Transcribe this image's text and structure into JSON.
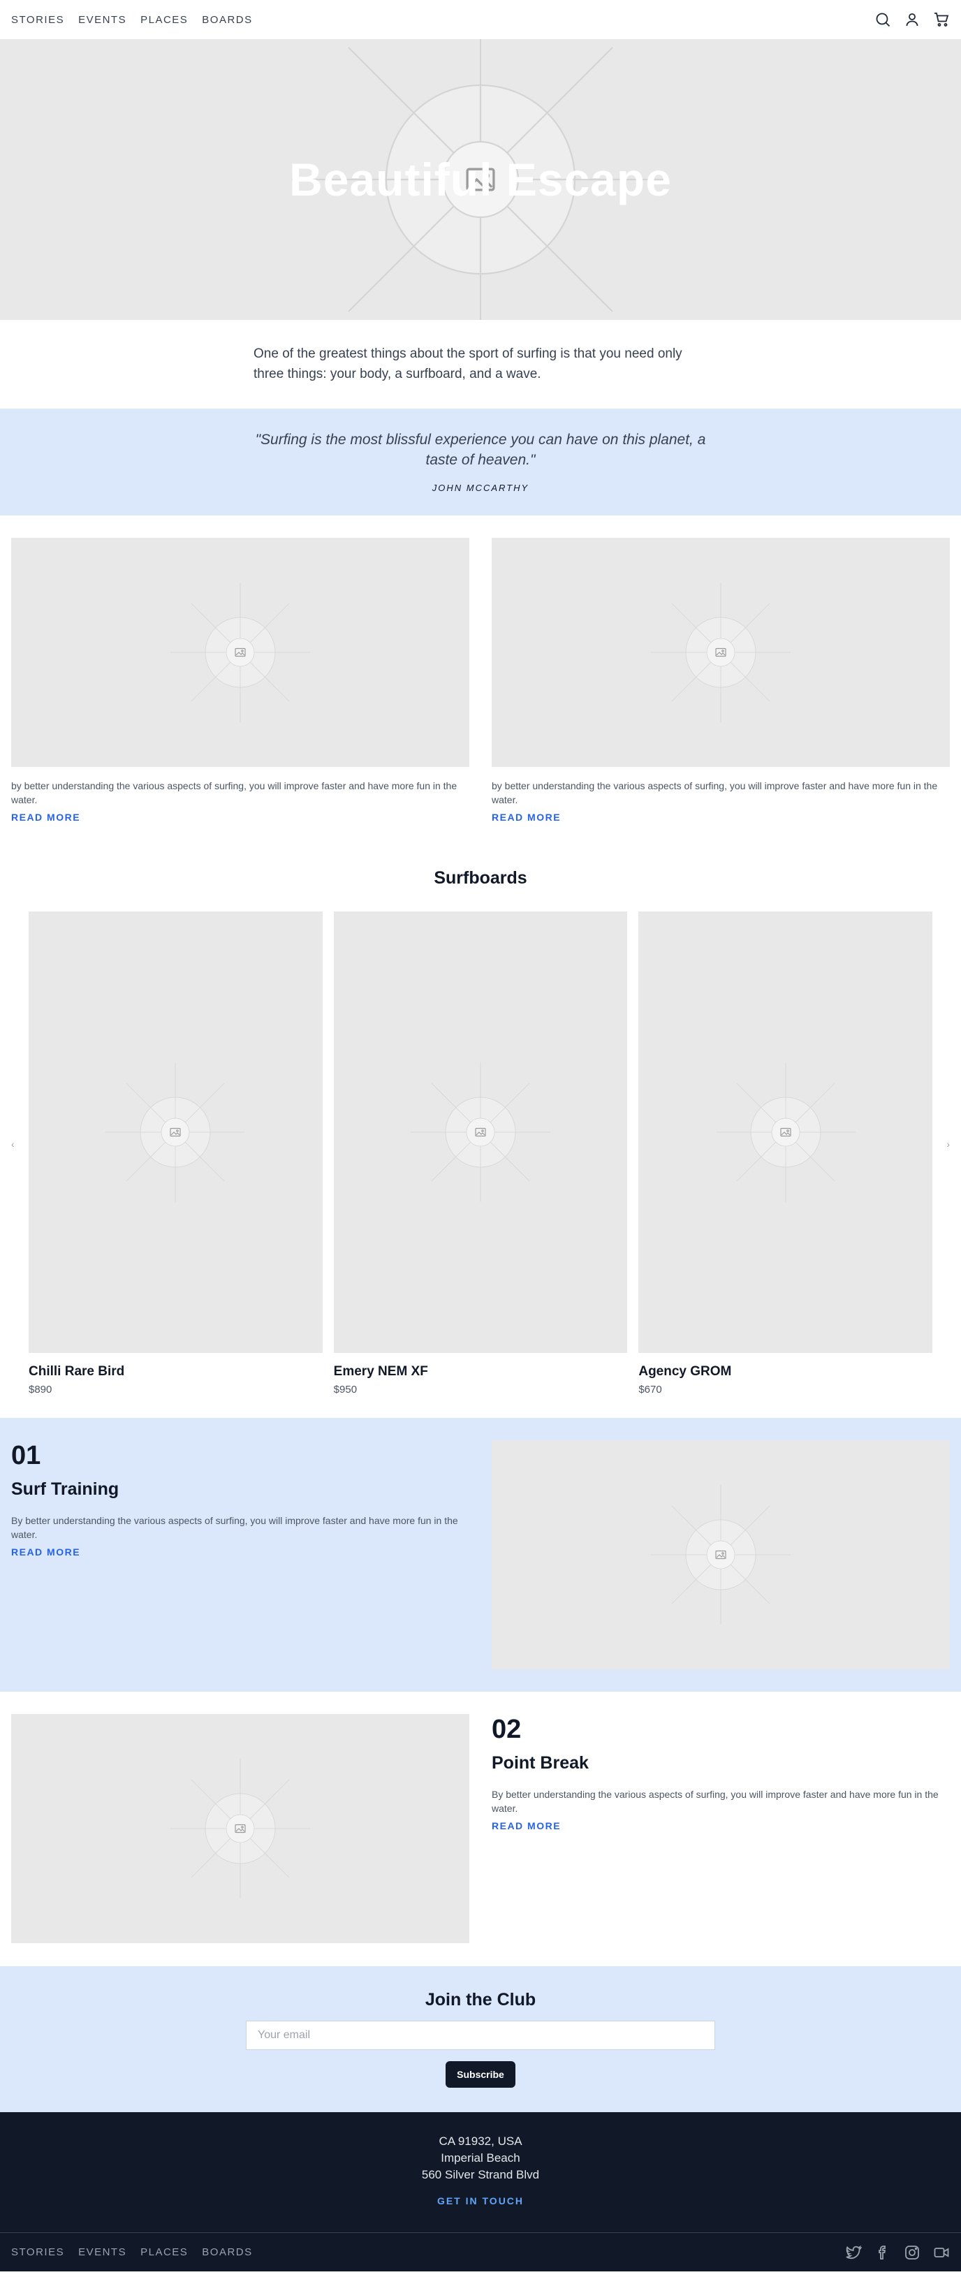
{
  "nav": {
    "links": [
      "STORIES",
      "EVENTS",
      "PLACES",
      "BOARDS"
    ],
    "icons": [
      "search-icon",
      "user-icon",
      "cart-icon"
    ]
  },
  "hero": {
    "title": "Beautiful Escape"
  },
  "intro": {
    "text": "One of the greatest things about the sport of surfing is that you need only three things: your body, a surfboard, and a wave."
  },
  "quote": {
    "text": "\"Surfing is the most blissful experience you can have on this planet, a taste of heaven.\"",
    "author": "JOHN MCCARTHY"
  },
  "articles": [
    {
      "text": "by better understanding the various aspects of surfing, you will improve faster and have more fun in the water.",
      "cta": "READ MORE"
    },
    {
      "text": "by better understanding the various aspects of surfing, you will improve faster and have more fun in the water.",
      "cta": "READ MORE"
    }
  ],
  "boards": {
    "title": "Surfboards",
    "prev": "‹",
    "next": "›",
    "items": [
      {
        "name": "Chilli Rare Bird",
        "price": "$890"
      },
      {
        "name": "Emery NEM XF",
        "price": "$950"
      },
      {
        "name": "Agency GROM",
        "price": "$670"
      }
    ]
  },
  "features": [
    {
      "number": "01",
      "title": "Surf Training",
      "text": "By better understanding the various aspects of surfing, you will improve faster and have more fun in the water.",
      "cta": "READ MORE"
    },
    {
      "number": "02",
      "title": "Point Break",
      "text": "By better understanding the various aspects of surfing, you will improve faster and have more fun in the water.",
      "cta": "READ MORE"
    }
  ],
  "club": {
    "title": "Join the Club",
    "placeholder": "Your email",
    "button": "Subscribe"
  },
  "footer": {
    "address_lines": [
      "CA 91932, USA",
      "Imperial Beach",
      "560 Silver Strand Blvd"
    ],
    "cta": "GET IN TOUCH",
    "links": [
      "STORIES",
      "EVENTS",
      "PLACES",
      "BOARDS"
    ],
    "social_icons": [
      "twitter-icon",
      "facebook-icon",
      "instagram-icon",
      "video-icon"
    ]
  },
  "colors": {
    "accent_blue": "#2563eb",
    "band_blue": "#dbe8fb",
    "footer_dark": "#111827",
    "placeholder_gray": "#e8e8e8"
  }
}
